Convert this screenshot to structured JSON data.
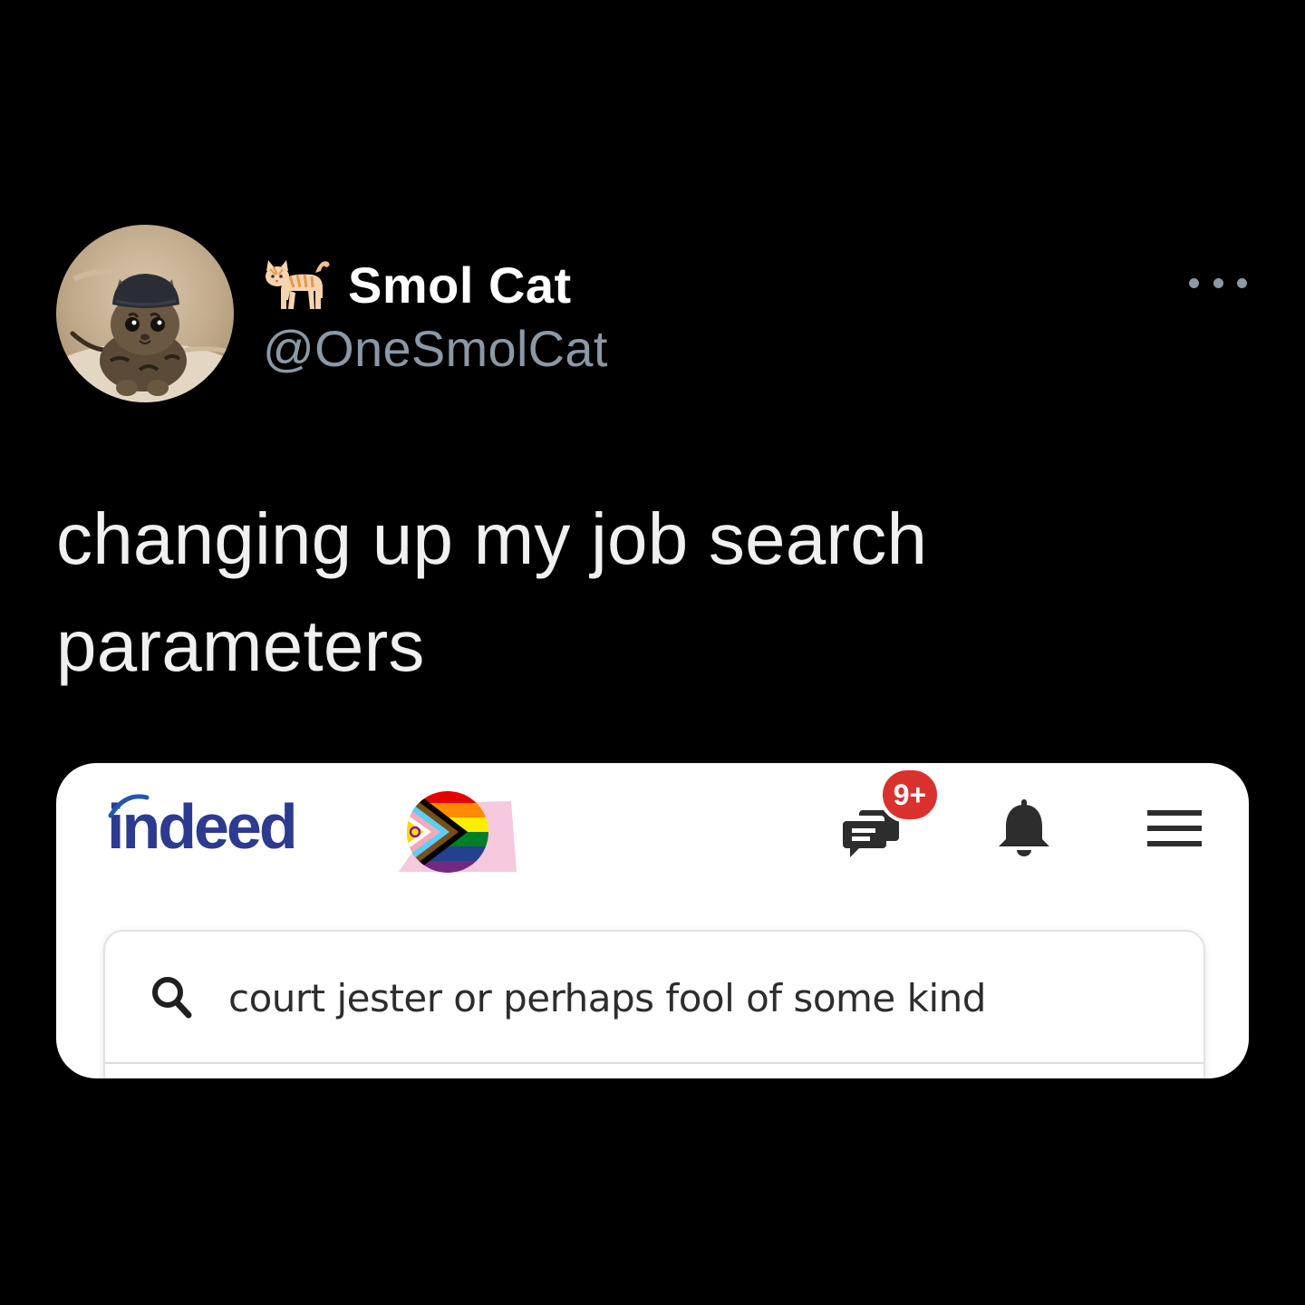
{
  "tweet": {
    "author": {
      "display_name": "Smol Cat",
      "name_emoji": "cat-emoji",
      "handle": "@OneSmolCat",
      "avatar": "kitten-wearing-beanie"
    },
    "more_icon": "more-dots-icon",
    "text": "changing up my job search parameters"
  },
  "embedded_screenshot": {
    "logo_text": "indeed",
    "logo_color": "#2c3b8f",
    "pride_badge": "progress-pride-flag-badge",
    "header_icons": {
      "messages": "chat-bubble-icon",
      "notifications": "bell-icon",
      "menu": "hamburger-menu-icon"
    },
    "message_badge": "9+",
    "badge_color": "#d9322e",
    "search": {
      "icon": "search-icon",
      "value": "court jester or perhaps fool of some kind"
    }
  }
}
